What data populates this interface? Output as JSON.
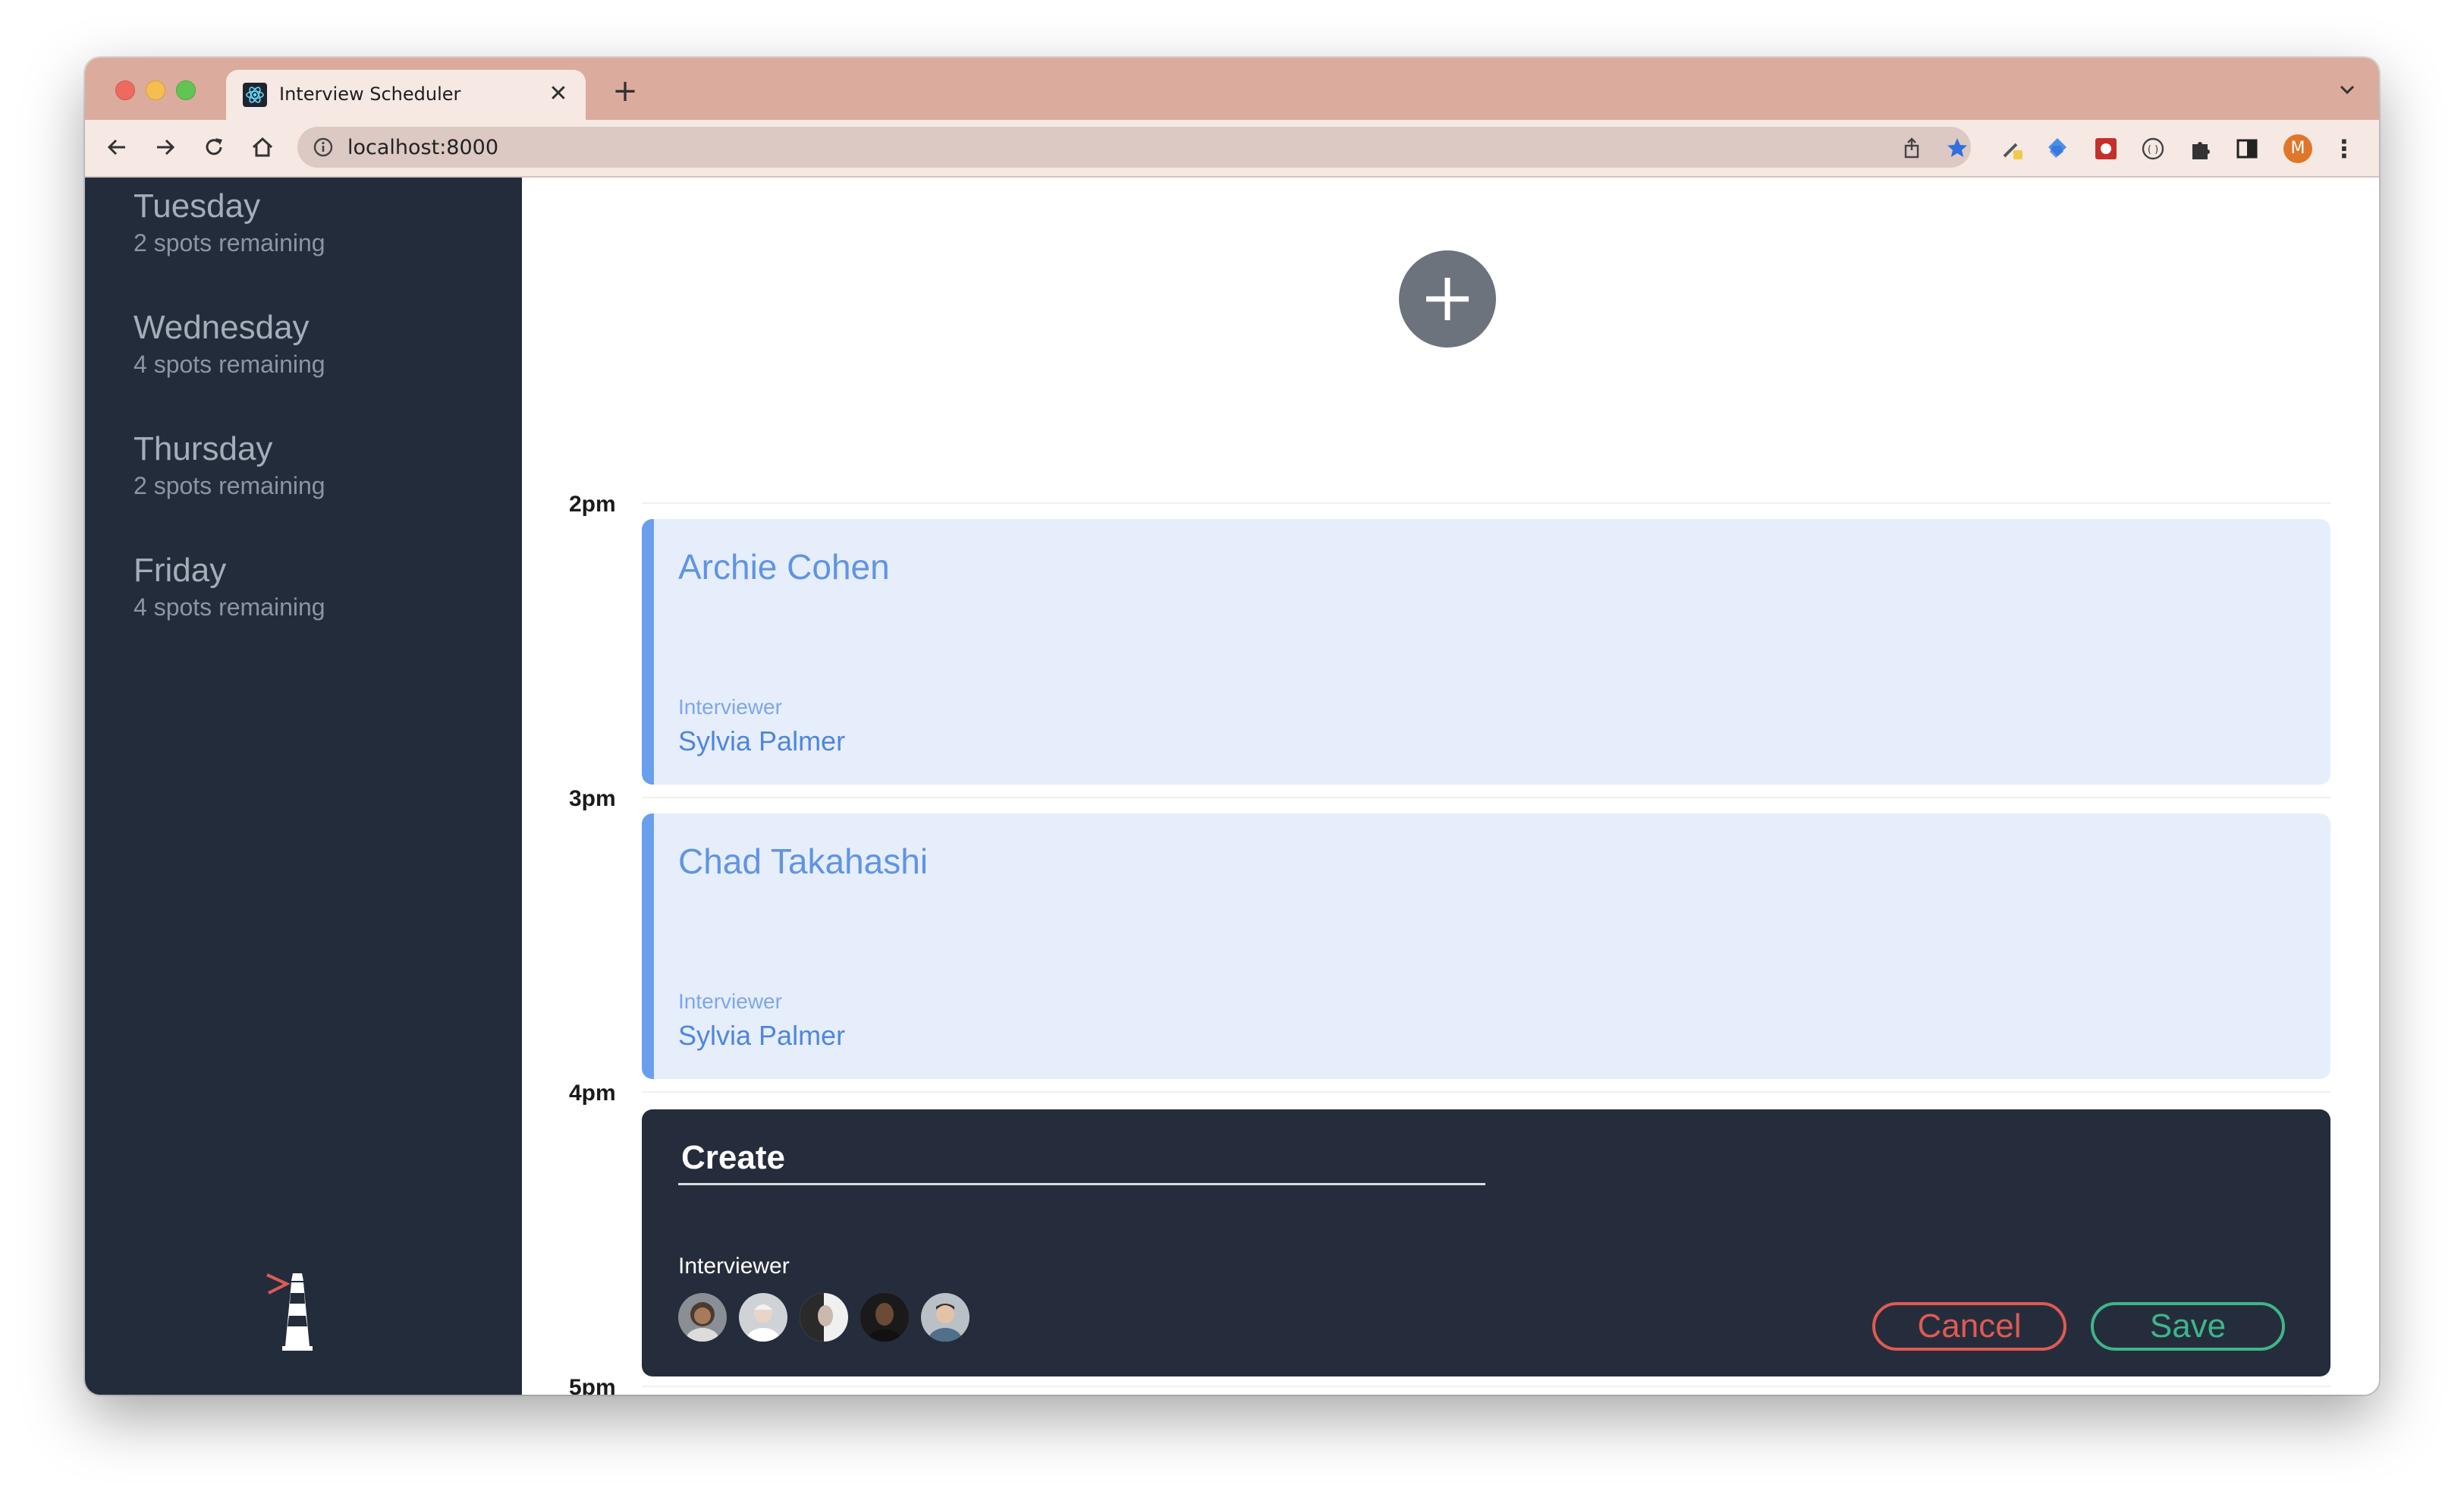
{
  "browser": {
    "tab_title": "Interview Scheduler",
    "tab_close": "✕",
    "new_tab": "+",
    "url": "localhost:8000",
    "profile_initial": "M",
    "menu": "⋮"
  },
  "sidebar": {
    "days": [
      {
        "name": "Tuesday",
        "spots": "2 spots remaining"
      },
      {
        "name": "Wednesday",
        "spots": "4 spots remaining"
      },
      {
        "name": "Thursday",
        "spots": "2 spots remaining"
      },
      {
        "name": "Friday",
        "spots": "4 spots remaining"
      }
    ]
  },
  "schedule": {
    "hours": [
      "2pm",
      "3pm",
      "4pm",
      "5pm"
    ],
    "appointments": [
      {
        "student": "Archie Cohen",
        "interviewer_label": "Interviewer",
        "interviewer": "Sylvia Palmer"
      },
      {
        "student": "Chad Takahashi",
        "interviewer_label": "Interviewer",
        "interviewer": "Sylvia Palmer"
      }
    ]
  },
  "form": {
    "name_value": "Create",
    "interviewer_heading": "Interviewer",
    "cancel_label": "Cancel",
    "save_label": "Save"
  },
  "colors": {
    "sidebar_bg": "#232c3b",
    "appointment_bg": "#e6eefb",
    "appointment_accent": "#6a9fee",
    "form_bg": "#252d3c",
    "cancel": "#e05a52",
    "save": "#3fb58a",
    "tabstrip": "#dbab9d"
  }
}
